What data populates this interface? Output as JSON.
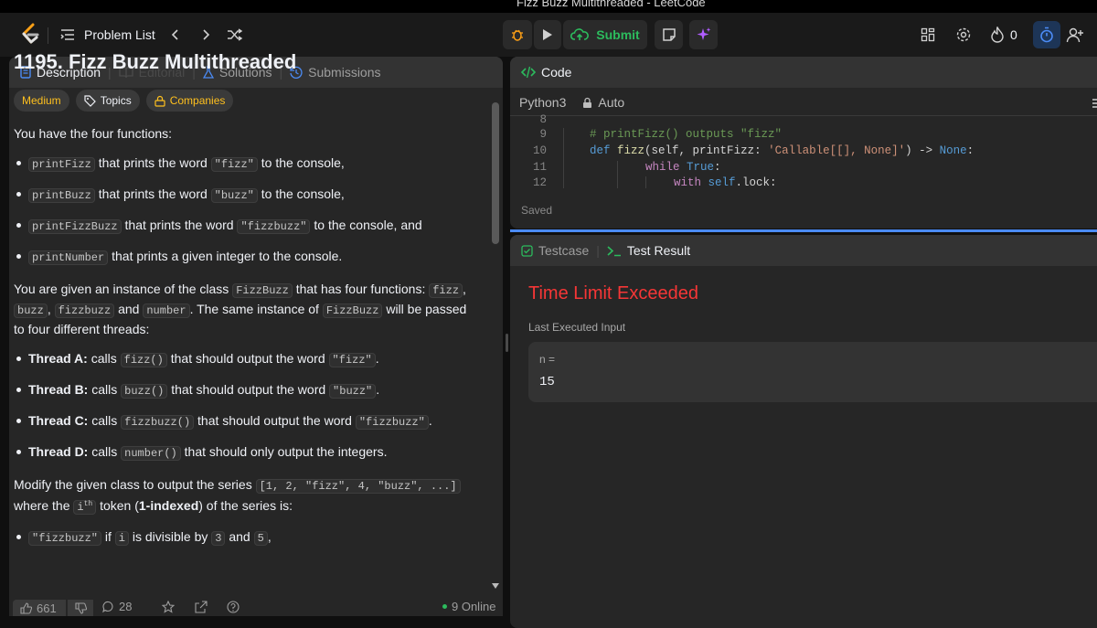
{
  "window": {
    "title": "Fizz Buzz Multithreaded - LeetCode"
  },
  "topnav": {
    "problem_list_label": "Problem List",
    "submit_label": "Submit",
    "streak_count": "0",
    "colors": {
      "submit": "#2cbb5d",
      "accent_blue": "#4b8bf5"
    }
  },
  "description_tabs": [
    {
      "label": "Description",
      "icon": "description-icon"
    },
    {
      "label": "Editorial",
      "icon": "editorial-icon"
    },
    {
      "label": "Solutions",
      "icon": "solutions-icon"
    },
    {
      "label": "Submissions",
      "icon": "submissions-icon"
    }
  ],
  "problem": {
    "title": "1195. Fizz Buzz Multithreaded",
    "difficulty": "Medium",
    "topics_label": "Topics",
    "companies_label": "Companies",
    "intro": "You have the four functions:",
    "functions": [
      {
        "name": "printFizz",
        "pre": " that prints the word ",
        "word": "\"fizz\"",
        "post": " to the console,"
      },
      {
        "name": "printBuzz",
        "pre": " that prints the word ",
        "word": "\"buzz\"",
        "post": " to the console,"
      },
      {
        "name": "printFizzBuzz",
        "pre": " that prints the word ",
        "word": "\"fizzbuzz\"",
        "post": " to the console, and"
      },
      {
        "name": "printNumber",
        "pre": " that prints a given integer to the console.",
        "word": "",
        "post": ""
      }
    ],
    "instance_text": {
      "a": "You are given an instance of the class ",
      "class": "FizzBuzz",
      "b": " that has four functions: ",
      "f1": "fizz",
      "c": ",",
      "f2": "buzz",
      "d": ", ",
      "f3": "fizzbuzz",
      "e": " and ",
      "f4": "number",
      "f": ". The same instance of ",
      "class2": "FizzBuzz",
      "g": " will be passed to four different threads:"
    },
    "threads": [
      {
        "label": "Thread A:",
        "pre": " calls ",
        "call": "fizz()",
        "mid": " that should output the word ",
        "word": "\"fizz\"",
        "post": "."
      },
      {
        "label": "Thread B:",
        "pre": " calls ",
        "call": "buzz()",
        "mid": " that should output the word ",
        "word": "\"buzz\"",
        "post": "."
      },
      {
        "label": "Thread C:",
        "pre": " calls ",
        "call": "fizzbuzz()",
        "mid": " that should output the word ",
        "word": "\"fizzbuzz\"",
        "post": "."
      },
      {
        "label": "Thread D:",
        "pre": " calls ",
        "call": "number()",
        "mid": " that should only output the integers.",
        "word": "",
        "post": ""
      }
    ],
    "modify_text": {
      "a": "Modify the given class to output the series ",
      "series": "[1, 2, \"fizz\", 4, \"buzz\", ...]",
      "b": " where the ",
      "ith": "i",
      "th": "th",
      "c": " token (",
      "bold": "1-indexed",
      "d": ") of the series is:"
    },
    "rule": {
      "word": "\"fizzbuzz\"",
      "a": " if ",
      "i": "i",
      "b": " is divisible by ",
      "n1": "3",
      "c": " and ",
      "n2": "5",
      "d": ","
    }
  },
  "footer": {
    "likes": "661",
    "comments": "28",
    "online": "9 Online"
  },
  "code_panel": {
    "tab_label": "Code",
    "language": "Python3",
    "mode": "Auto",
    "status": "Saved",
    "lines": [
      {
        "n": "8"
      },
      {
        "n": "9"
      },
      {
        "n": "10"
      },
      {
        "n": "11"
      },
      {
        "n": "12"
      }
    ],
    "snippets": {
      "l9": "# printFizz() outputs \"fizz\"",
      "def": "def",
      "fname": "fizz",
      "sig_a": "(self, printFizz: ",
      "sig_str": "'Callable[[], None]'",
      "sig_b": ") -> ",
      "none": "None",
      "colon": ":",
      "while": "while",
      "true": "True",
      "with": "with",
      "self": "self",
      "lock": ".lock:"
    }
  },
  "result_panel": {
    "tabs": [
      {
        "label": "Testcase",
        "icon": "checkbox-icon"
      },
      {
        "label": "Test Result",
        "icon": "terminal-icon"
      }
    ],
    "verdict": "Time Limit Exceeded",
    "verdict_color": "#f63636",
    "last_input_label": "Last Executed Input",
    "var_label": "n =",
    "var_value": "15"
  }
}
